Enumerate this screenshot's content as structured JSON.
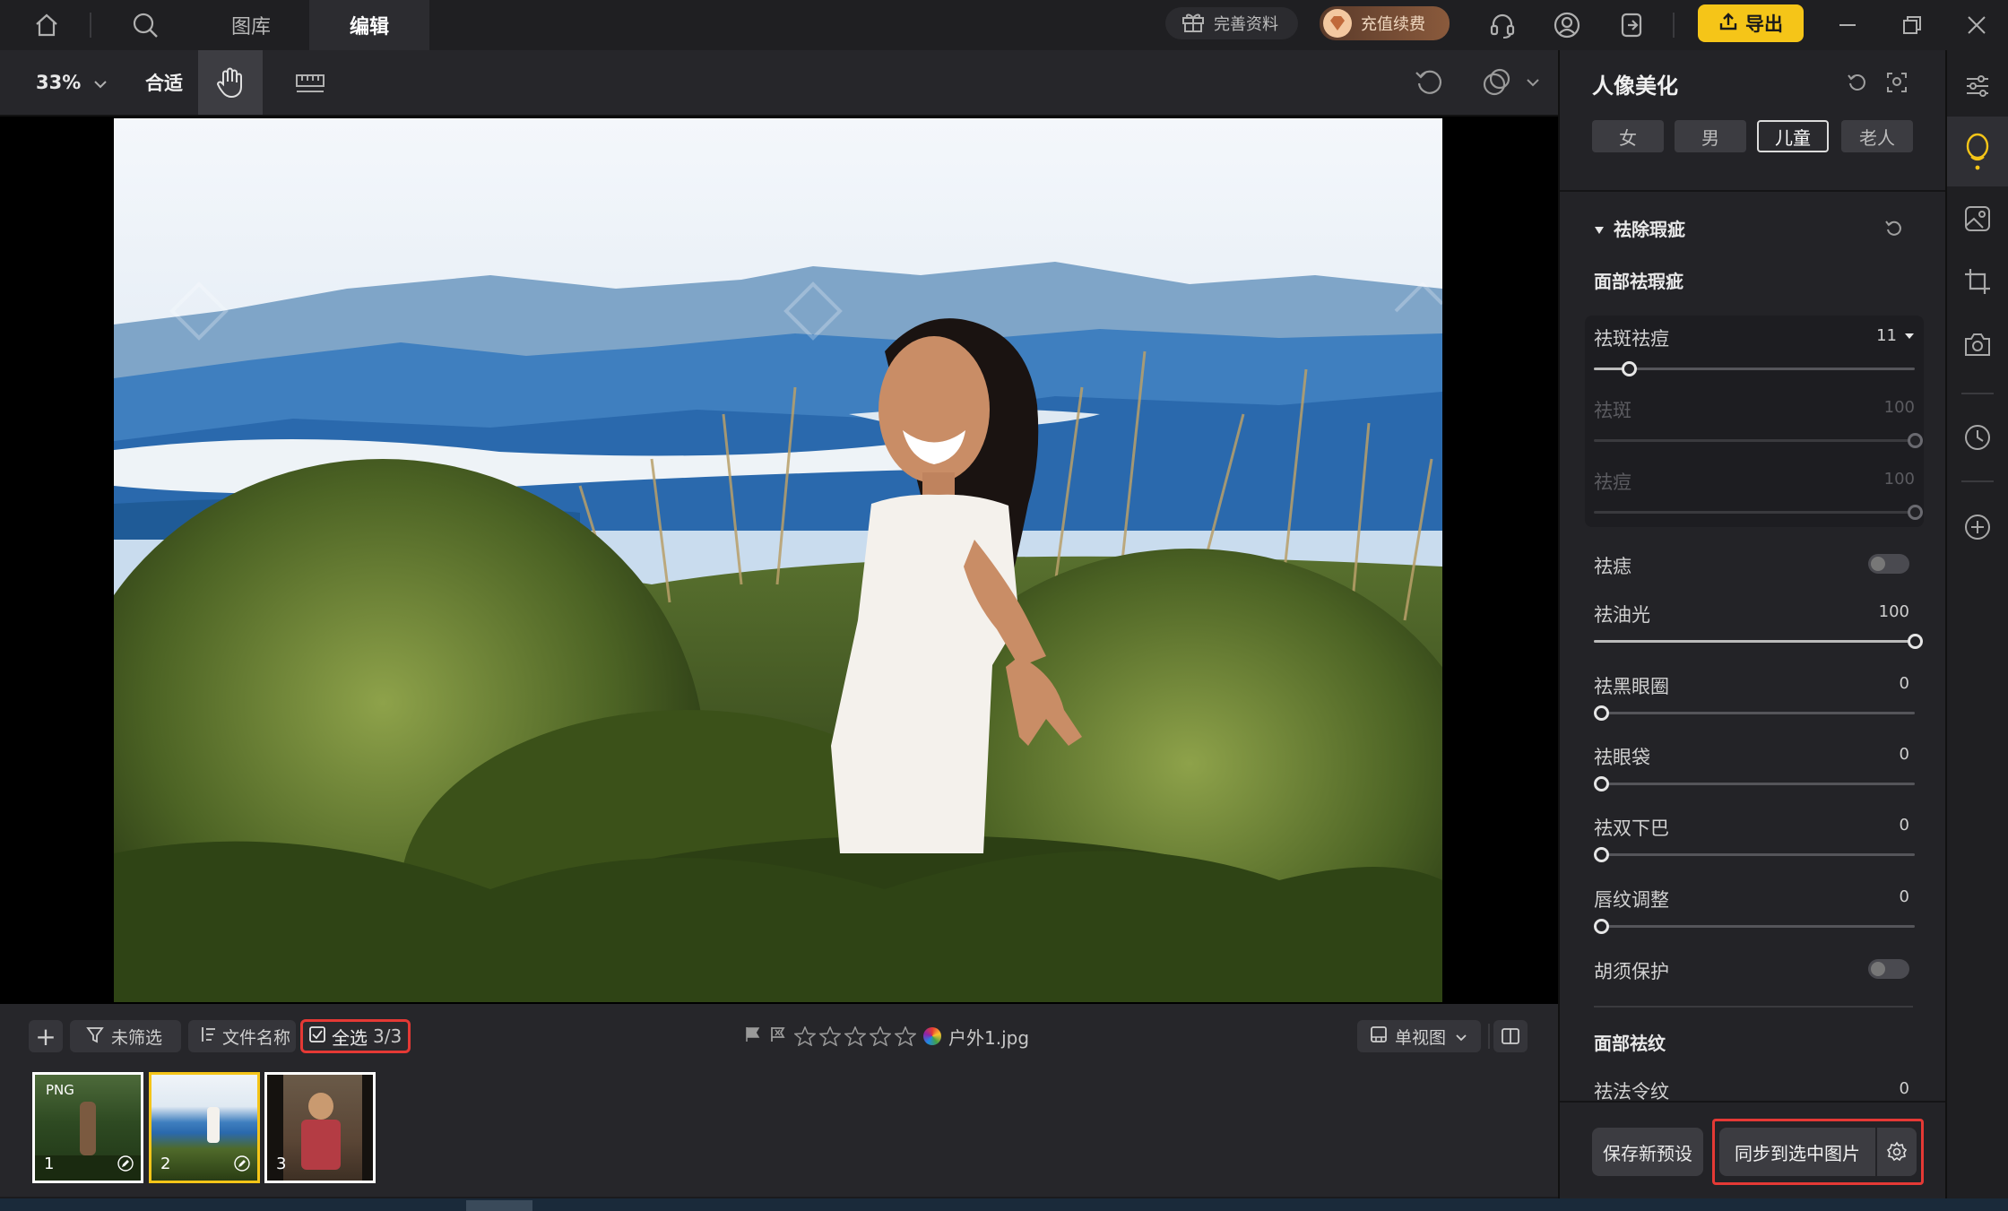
{
  "topbar": {
    "tabs": [
      "图库",
      "编辑"
    ],
    "profile_btn": "完善资料",
    "recharge_btn": "充值续费",
    "export_btn": "导出",
    "icons": [
      "home-icon",
      "search-icon",
      "headset-icon",
      "user-icon",
      "exit-icon",
      "minimize-icon",
      "restore-icon",
      "close-icon"
    ]
  },
  "toolbar": {
    "zoom": "33%",
    "fit": "合适"
  },
  "filmstrip": {
    "add": "+",
    "filter": "未筛选",
    "sort": "文件名称",
    "select_all": "全选",
    "select_count": "3/3",
    "filename": "户外1.jpg",
    "rating": 0,
    "view_mode": "单视图",
    "thumbs": [
      {
        "num": "1",
        "badge": "PNG",
        "edited": true
      },
      {
        "num": "2",
        "badge": "",
        "edited": true
      },
      {
        "num": "3",
        "badge": "",
        "edited": false
      }
    ]
  },
  "panel": {
    "title": "人像美化",
    "genders": [
      "女",
      "男",
      "儿童",
      "老人"
    ],
    "selected_gender": "儿童",
    "section": "祛除瑕疵",
    "face_blemish": "面部祛瑕疵",
    "sliders": [
      {
        "label": "祛斑祛痘",
        "value": "11",
        "level": 0.11,
        "dim": false
      },
      {
        "label": "祛斑",
        "value": "100",
        "level": 1.0,
        "dim": true
      },
      {
        "label": "祛痘",
        "value": "100",
        "level": 1.0,
        "dim": true
      }
    ],
    "mole": "祛痣",
    "oil": {
      "label": "祛油光",
      "value": "100",
      "level": 1.0
    },
    "dark_circles": {
      "label": "祛黑眼圈",
      "value": "0",
      "level": 0
    },
    "eye_bags": {
      "label": "祛眼袋",
      "value": "0",
      "level": 0
    },
    "double_chin": {
      "label": "祛双下巴",
      "value": "0",
      "level": 0
    },
    "lip_lines": {
      "label": "唇纹调整",
      "value": "0",
      "level": 0
    },
    "beard": "胡须保护",
    "wrinkle_section": "面部祛纹",
    "nasolabial": {
      "label": "祛法令纹",
      "value": "0"
    },
    "save_preset": "保存新预设",
    "sync": "同步到选中图片"
  },
  "colors": {
    "accent_gold": "#f5c518",
    "highlight_red": "#e53935",
    "thumb_selected": "#f5c518"
  }
}
